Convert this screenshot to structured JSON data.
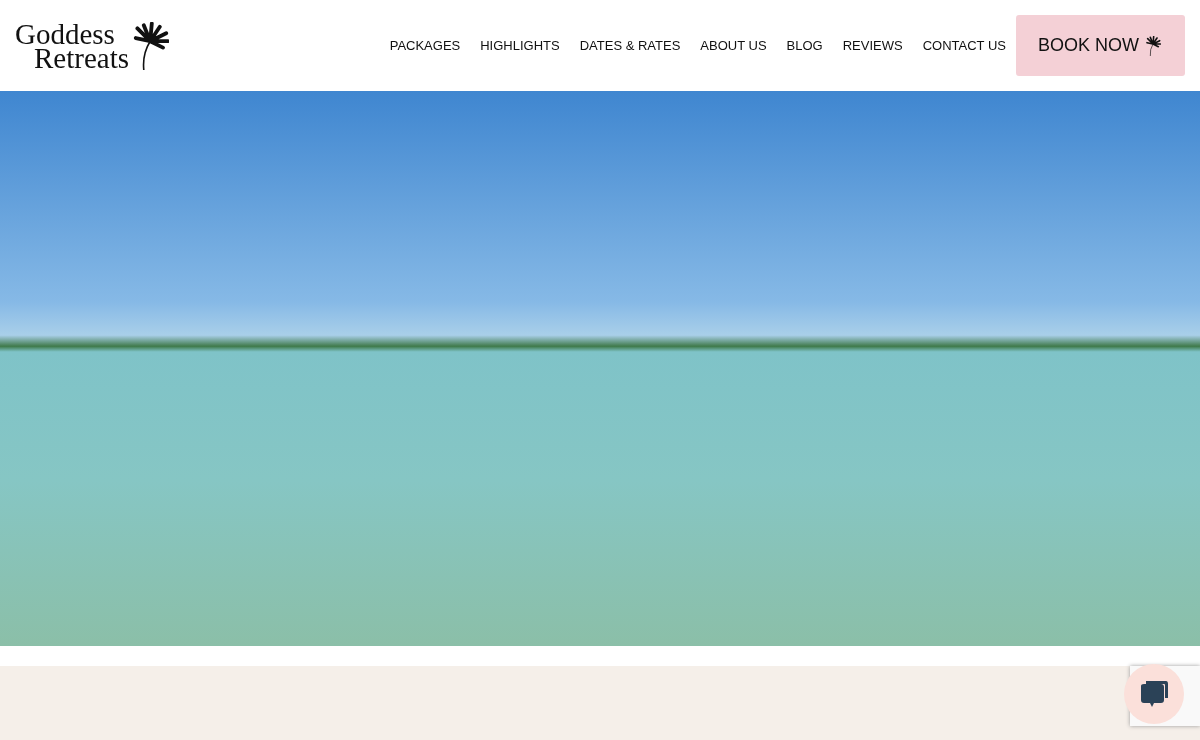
{
  "logo": {
    "line_1": "Goddess",
    "line_2": "Retreats"
  },
  "nav": [
    {
      "label": "PACKAGES"
    },
    {
      "label": "HIGHLIGHTS"
    },
    {
      "label": "DATES & RATES"
    },
    {
      "label": "ABOUT US"
    },
    {
      "label": "BLOG"
    },
    {
      "label": "REVIEWS"
    },
    {
      "label": "CONTACT US"
    }
  ],
  "cta": {
    "label": "BOOK NOW"
  }
}
